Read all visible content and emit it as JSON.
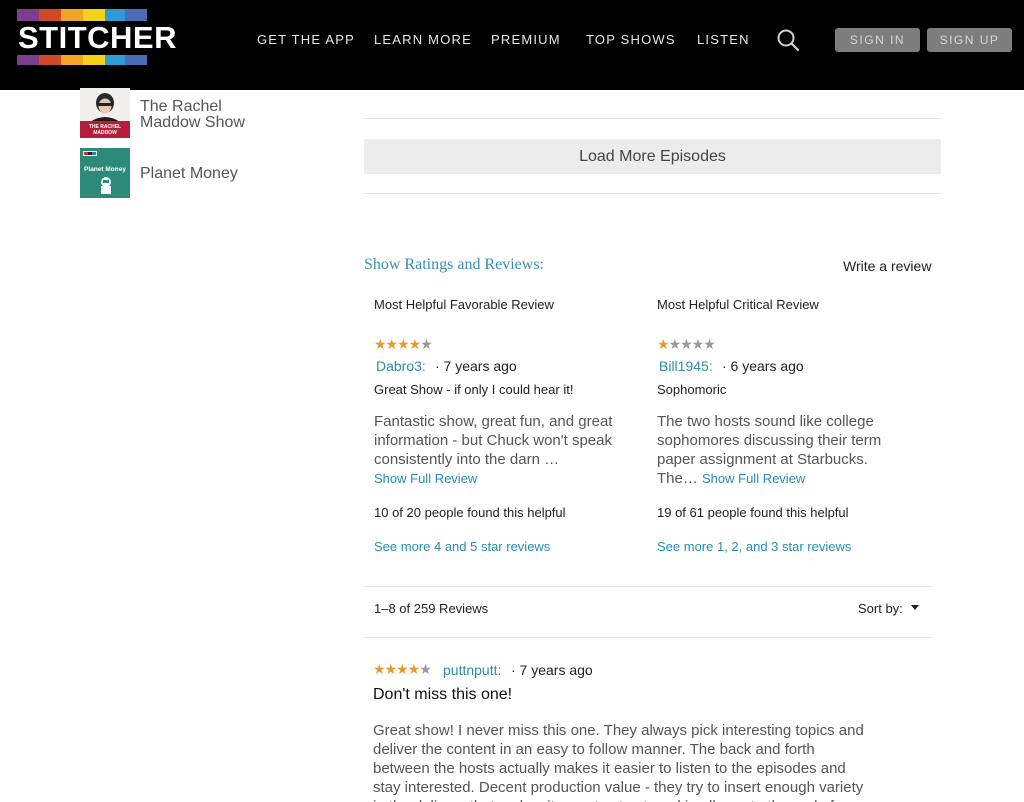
{
  "header": {
    "logo_text": "STITCHER",
    "logo_colors": [
      "#7b3f8e",
      "#d04a2a",
      "#f2a623",
      "#f4d21a",
      "#2f9bd6",
      "#4b6bb7"
    ],
    "nav": [
      "GET THE APP",
      "LEARN MORE",
      "PREMIUM",
      "TOP SHOWS",
      "LISTEN"
    ],
    "search_icon": "search-icon",
    "sign_in": "SIGN IN",
    "sign_up": "SIGN UP"
  },
  "sidebar": {
    "items": [
      {
        "title_line1": "The Rachel",
        "title_line2": "Maddow Show",
        "thumb_label": "THE RACHEL MADDOW SHOW"
      },
      {
        "title_line1": "Planet Money",
        "thumb_label": "Planet Money",
        "thumb_badge": "NPR"
      }
    ]
  },
  "episodes": {
    "load_more": "Load More Episodes"
  },
  "ratings": {
    "section_title": "Show Ratings and Reviews:",
    "write_review": "Write a review",
    "favorable": {
      "heading": "Most Helpful Favorable Review",
      "rating": 4,
      "author": "Dabro3:",
      "ago": "· 7 years ago",
      "title": "Great Show - if only I could hear it!",
      "body": "Fantastic show, great fun, and great information - but Chuck won't speak consistently into the darn …",
      "show_full": "Show Full Review",
      "helpful": "10 of 20 people found this helpful",
      "see_more": "See more 4 and 5 star reviews"
    },
    "critical": {
      "heading": "Most Helpful Critical Review",
      "rating": 1,
      "author": "Bill1945:",
      "ago": "· 6 years ago",
      "title": "Sophomoric",
      "body_lines": [
        "The two hosts sound like college",
        "sophomores discussing their term",
        "paper assignment at Starbucks."
      ],
      "body_tail": "The…",
      "show_full": "Show Full Review",
      "helpful": "19 of 61 people found this helpful",
      "see_more": "See more 1, 2, and 3 star reviews"
    },
    "list": {
      "count": "1–8 of 259 Reviews",
      "sort_by": "Sort by:",
      "reviews": [
        {
          "rating": 4,
          "author": "puttnputt:",
          "ago": "· 7 years ago",
          "title": "Don't miss this one!",
          "body": "Great show! I never miss this one. They always pick interesting topics and deliver the content in an easy to follow manner. The back and forth between the hosts actually makes it easier to listen to the episodes and stay interested. Decent production value - they try to insert enough variety in the delivery that makes it easy to stay tuned in all way to the end of each episode."
        }
      ]
    }
  },
  "colors": {
    "accent_blue": "#2a8cb3",
    "star_on": "#e89a2a",
    "star_off": "#9a9a9a",
    "header_bg": "#000000"
  }
}
